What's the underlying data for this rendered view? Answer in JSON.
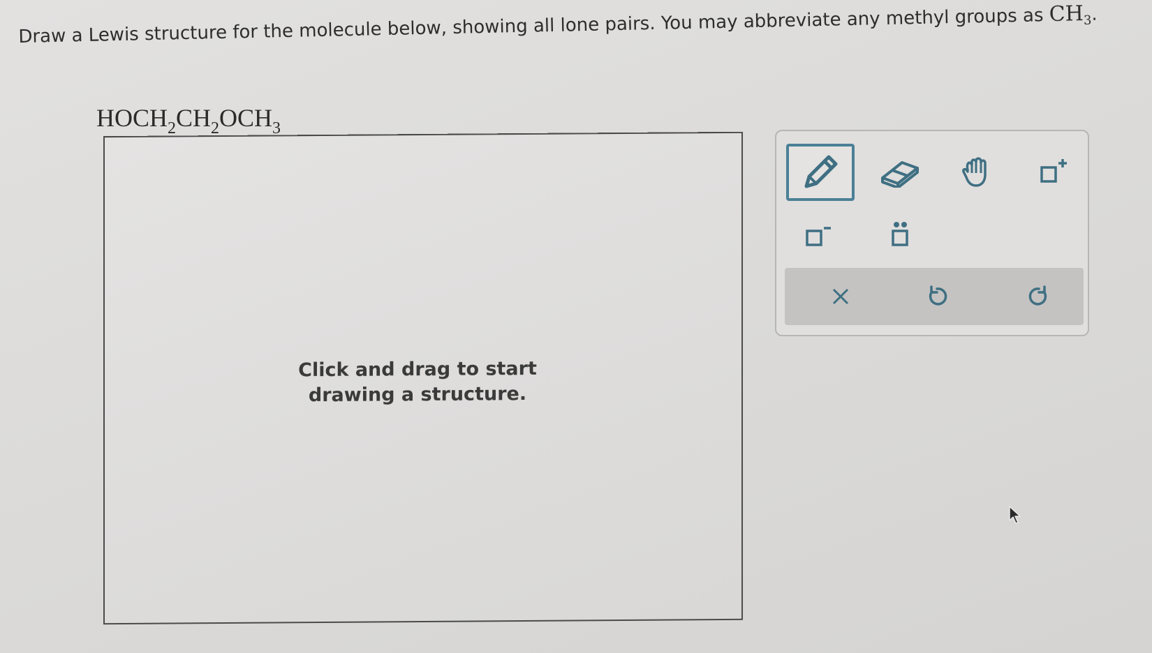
{
  "question": {
    "text": "Draw a Lewis structure for the molecule below, showing all lone pairs. You may abbreviate any methyl groups as",
    "methyl_main": "CH",
    "methyl_sub": "3",
    "end_punct": "."
  },
  "molecule": {
    "parts": [
      "HOCH",
      "2",
      "CH",
      "2",
      "OCH",
      "3"
    ]
  },
  "canvas": {
    "hint_line1": "Click and drag to start",
    "hint_line2": "drawing a structure."
  },
  "toolbar": {
    "selected_tool": "pencil-icon",
    "tools": [
      "pencil-icon",
      "eraser-icon",
      "hand-icon",
      "positive-charge-icon",
      "negative-charge-icon",
      "lone-pair-icon"
    ],
    "actions": [
      "clear-icon",
      "undo-icon",
      "redo-icon"
    ],
    "accent_color": "#4b8096"
  }
}
